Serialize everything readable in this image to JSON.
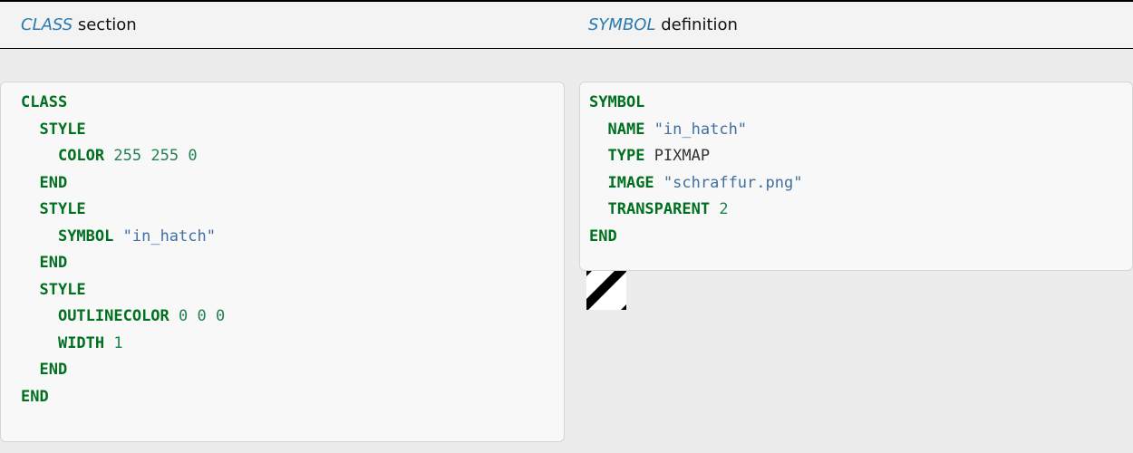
{
  "header": {
    "left": {
      "emph": "CLASS",
      "rest": " section"
    },
    "right": {
      "emph": "SYMBOL",
      "rest": " definition"
    }
  },
  "class_code": [
    [
      {
        "t": "kw",
        "v": "CLASS"
      }
    ],
    [
      {
        "t": "sp",
        "v": "  "
      },
      {
        "t": "kw",
        "v": "STYLE"
      }
    ],
    [
      {
        "t": "sp",
        "v": "    "
      },
      {
        "t": "kw",
        "v": "COLOR"
      },
      {
        "t": "sp",
        "v": " "
      },
      {
        "t": "num",
        "v": "255"
      },
      {
        "t": "sp",
        "v": " "
      },
      {
        "t": "num",
        "v": "255"
      },
      {
        "t": "sp",
        "v": " "
      },
      {
        "t": "num",
        "v": "0"
      }
    ],
    [
      {
        "t": "sp",
        "v": "  "
      },
      {
        "t": "kw",
        "v": "END"
      }
    ],
    [
      {
        "t": "sp",
        "v": "  "
      },
      {
        "t": "kw",
        "v": "STYLE"
      }
    ],
    [
      {
        "t": "sp",
        "v": "    "
      },
      {
        "t": "kw",
        "v": "SYMBOL"
      },
      {
        "t": "sp",
        "v": " "
      },
      {
        "t": "str",
        "v": "\"in_hatch\""
      }
    ],
    [
      {
        "t": "sp",
        "v": "  "
      },
      {
        "t": "kw",
        "v": "END"
      }
    ],
    [
      {
        "t": "sp",
        "v": "  "
      },
      {
        "t": "kw",
        "v": "STYLE"
      }
    ],
    [
      {
        "t": "sp",
        "v": "    "
      },
      {
        "t": "kw",
        "v": "OUTLINECOLOR"
      },
      {
        "t": "sp",
        "v": " "
      },
      {
        "t": "num",
        "v": "0"
      },
      {
        "t": "sp",
        "v": " "
      },
      {
        "t": "num",
        "v": "0"
      },
      {
        "t": "sp",
        "v": " "
      },
      {
        "t": "num",
        "v": "0"
      }
    ],
    [
      {
        "t": "sp",
        "v": "    "
      },
      {
        "t": "kw",
        "v": "WIDTH"
      },
      {
        "t": "sp",
        "v": " "
      },
      {
        "t": "num",
        "v": "1"
      }
    ],
    [
      {
        "t": "sp",
        "v": "  "
      },
      {
        "t": "kw",
        "v": "END"
      }
    ],
    [
      {
        "t": "kw",
        "v": "END"
      }
    ]
  ],
  "symbol_code": [
    [
      {
        "t": "kw",
        "v": "SYMBOL"
      }
    ],
    [
      {
        "t": "sp",
        "v": "  "
      },
      {
        "t": "kw",
        "v": "NAME"
      },
      {
        "t": "sp",
        "v": " "
      },
      {
        "t": "str",
        "v": "\"in_hatch\""
      }
    ],
    [
      {
        "t": "sp",
        "v": "  "
      },
      {
        "t": "kw",
        "v": "TYPE"
      },
      {
        "t": "sp",
        "v": " "
      },
      {
        "t": "plain",
        "v": "PIXMAP"
      }
    ],
    [
      {
        "t": "sp",
        "v": "  "
      },
      {
        "t": "kw",
        "v": "IMAGE"
      },
      {
        "t": "sp",
        "v": " "
      },
      {
        "t": "str",
        "v": "\"schraffur.png\""
      }
    ],
    [
      {
        "t": "sp",
        "v": "  "
      },
      {
        "t": "kw",
        "v": "TRANSPARENT"
      },
      {
        "t": "sp",
        "v": " "
      },
      {
        "t": "num",
        "v": "2"
      }
    ],
    [
      {
        "t": "kw",
        "v": "END"
      }
    ]
  ],
  "hatch_image": {
    "icon": "diagonal-hatch-image"
  }
}
